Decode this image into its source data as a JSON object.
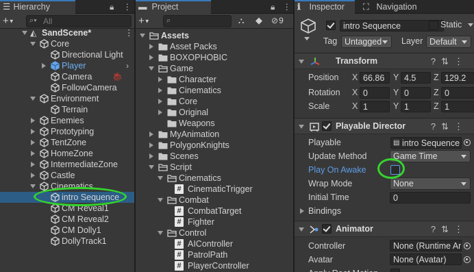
{
  "hierarchy": {
    "tab_label": "Hierarchy",
    "search_placeholder": "All",
    "scene_name": "SandScene*",
    "items": [
      {
        "label": "Core",
        "type": "go",
        "state": "down"
      },
      {
        "label": "Directional Light",
        "type": "go"
      },
      {
        "label": "Player",
        "type": "prefab",
        "state": "right"
      },
      {
        "label": "Camera",
        "type": "go"
      },
      {
        "label": "FollowCamera",
        "type": "go"
      },
      {
        "label": "Environment",
        "type": "go",
        "state": "down"
      },
      {
        "label": "Terrain",
        "type": "go"
      },
      {
        "label": "Enemies",
        "type": "go",
        "state": "right"
      },
      {
        "label": "Prototyping",
        "type": "go",
        "state": "right"
      },
      {
        "label": "TentZone",
        "type": "go",
        "state": "right"
      },
      {
        "label": "HomeZone",
        "type": "go",
        "state": "right"
      },
      {
        "label": "IntermediateZone",
        "type": "go",
        "state": "right"
      },
      {
        "label": "Castle",
        "type": "go",
        "state": "right"
      },
      {
        "label": "Cinematics",
        "type": "go",
        "state": "down"
      },
      {
        "label": "intro Sequence",
        "type": "go",
        "selected": true
      },
      {
        "label": "CM Reveal1",
        "type": "go"
      },
      {
        "label": "CM Reveal2",
        "type": "go"
      },
      {
        "label": "CM Dolly1",
        "type": "go"
      },
      {
        "label": "DollyTrack1",
        "type": "go"
      }
    ]
  },
  "project": {
    "tab_label": "Project",
    "hidden_count": "9",
    "items": [
      {
        "label": "Assets",
        "kind": "folder-open",
        "bold": true
      },
      {
        "label": "Asset Packs",
        "kind": "folder"
      },
      {
        "label": "BOXOPHOBIC",
        "kind": "folder"
      },
      {
        "label": "Game",
        "kind": "folder-open"
      },
      {
        "label": "Character",
        "kind": "folder"
      },
      {
        "label": "Cinematics",
        "kind": "folder"
      },
      {
        "label": "Core",
        "kind": "folder"
      },
      {
        "label": "Original",
        "kind": "folder"
      },
      {
        "label": "Weapons",
        "kind": "folder-noarrow"
      },
      {
        "label": "MyAnimation",
        "kind": "folder"
      },
      {
        "label": "PolygonKnights",
        "kind": "folder"
      },
      {
        "label": "Scenes",
        "kind": "folder"
      },
      {
        "label": "Script",
        "kind": "folder-open"
      },
      {
        "label": "Cinematics",
        "kind": "folder-open"
      },
      {
        "label": "CinematicTrigger",
        "kind": "script"
      },
      {
        "label": "Combat",
        "kind": "folder-open"
      },
      {
        "label": "CombatTarget",
        "kind": "script"
      },
      {
        "label": "Fighter",
        "kind": "script"
      },
      {
        "label": "Control",
        "kind": "folder-open"
      },
      {
        "label": "AIController",
        "kind": "script"
      },
      {
        "label": "PatrolPath",
        "kind": "script"
      },
      {
        "label": "PlayerController",
        "kind": "script"
      }
    ]
  },
  "inspector": {
    "tab_label": "Inspector",
    "nav_tab_label": "Navigation",
    "object_name": "intro Sequence",
    "static_label": "Static",
    "tag_label": "Tag",
    "tag_value": "Untagged",
    "layer_label": "Layer",
    "layer_value": "Default",
    "transform": {
      "title": "Transform",
      "position_label": "Position",
      "rotation_label": "Rotation",
      "scale_label": "Scale",
      "position": {
        "x": "66.86",
        "y": "4.5",
        "z": "129.2"
      },
      "rotation": {
        "x": "0",
        "y": "0",
        "z": "0"
      },
      "scale": {
        "x": "1",
        "y": "1",
        "z": "1"
      }
    },
    "playable_director": {
      "title": "Playable Director",
      "playable_label": "Playable",
      "playable_value": "intro Sequence",
      "update_method_label": "Update Method",
      "update_method_value": "Game Time",
      "play_on_awake_label": "Play On Awake",
      "wrap_mode_label": "Wrap Mode",
      "wrap_mode_value": "None",
      "initial_time_label": "Initial Time",
      "initial_time_value": "0",
      "bindings_label": "Bindings"
    },
    "animator": {
      "title": "Animator",
      "controller_label": "Controller",
      "controller_value": "None (Runtime Ar",
      "avatar_label": "Avatar",
      "avatar_value": "None (Avatar)",
      "apply_root_motion_label": "Apply Root Motion"
    }
  },
  "colors": {
    "highlight_ring": "#35d42d",
    "selection": "#2c5d87",
    "link_blue": "#5e9de6"
  }
}
